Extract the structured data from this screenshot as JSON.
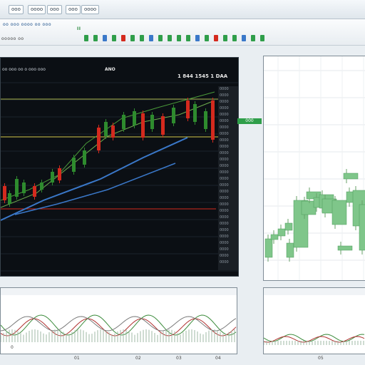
{
  "top_tabs": [
    "ooo",
    "oooo",
    "ooo",
    "ooo",
    "oooo"
  ],
  "toolbar_title": "oo ooo oooo oo ooo",
  "toolbar_text": "ooooo oo",
  "toolbar_indicator": "II",
  "main_header": "oo ooo oo o ooo ooo",
  "main_tag": "ANO",
  "main_value": "1 844 1545 1 DAA",
  "side_price_tag": "000",
  "bottom_left_label": "0",
  "bottom_axis_labels": [
    "01",
    "02",
    "03",
    "04",
    "05"
  ],
  "colors": {
    "up": "#2e8b2e",
    "down": "#d42a1e",
    "trend": "#3a78c9",
    "accent": "#2f9e4a"
  }
}
